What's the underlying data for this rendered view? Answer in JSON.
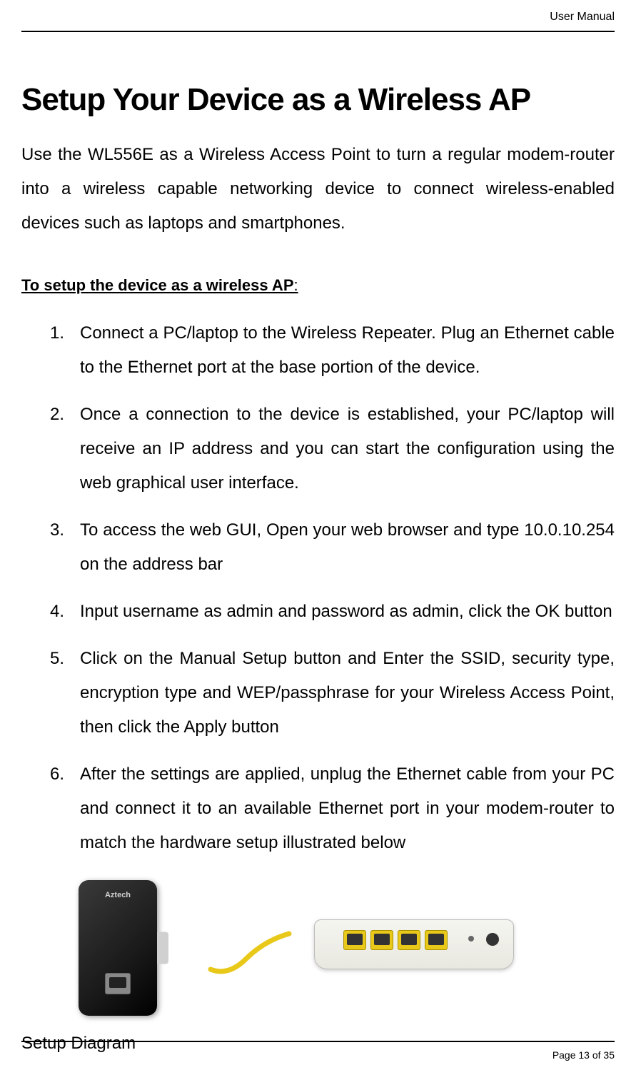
{
  "header": {
    "doc_title": "User Manual"
  },
  "main": {
    "heading": "Setup Your Device as a Wireless AP",
    "intro": "Use the WL556E as a Wireless Access Point to turn a regular modem-router into a wireless capable networking device to connect wireless-enabled devices such as laptops and smartphones.",
    "subheading": "To setup the device as a wireless AP",
    "subheading_colon": ":",
    "steps": [
      "Connect a PC/laptop to the Wireless Repeater. Plug an Ethernet cable to the Ethernet port at the base portion of the device.",
      "Once a connection to the device is established, your PC/laptop will receive an IP address and you can start the configuration using the web graphical user interface.",
      "To access the web GUI, Open your web browser and type 10.0.10.254 on the address bar",
      "Input username as admin and password as admin, click the OK button",
      "Click on the Manual Setup button and Enter the SSID, security type, encryption type and WEP/passphrase for your Wireless Access Point, then click the Apply button",
      "After the settings are applied, unplug the Ethernet cable from your PC and connect it to an available Ethernet port in your modem-router to match the hardware setup illustrated below"
    ],
    "diagram_caption": "Setup Diagram",
    "repeater_brand": "Aztech"
  },
  "footer": {
    "page_text": "Page 13 of 35"
  }
}
